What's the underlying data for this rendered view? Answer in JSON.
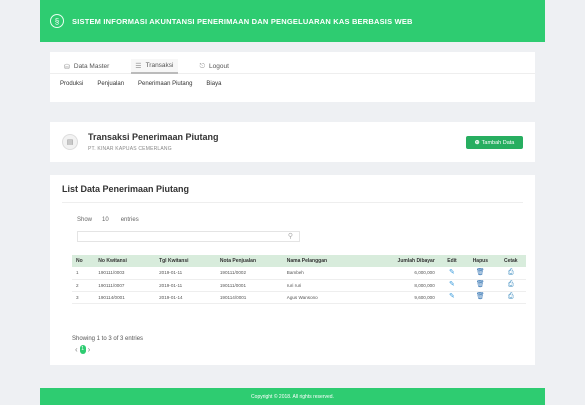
{
  "app": {
    "title": "SISTEM INFORMASI AKUNTANSI PENERIMAAN DAN PENGELUARAN KAS BERBASIS WEB"
  },
  "colors": {
    "accent": "#2ecc71",
    "button_green": "#27ae60",
    "table_header": "#d8ecdc"
  },
  "nav": {
    "main": [
      {
        "label": "Data Master",
        "icon": "database-icon"
      },
      {
        "label": "Transaksi",
        "icon": "list-icon"
      },
      {
        "label": "Logout",
        "icon": "logout-icon"
      }
    ],
    "sub": [
      "Produksi",
      "Penjualan",
      "Penerimaan Piutang",
      "Biaya"
    ]
  },
  "page": {
    "title": "Transaksi Penerimaan Piutang",
    "subtitle": "PT. KINAR KAPUAS CEMERLANG",
    "add_button": "Tambah Data"
  },
  "list": {
    "title": "List Data Penerimaan Piutang",
    "show_label": "Show",
    "show_value": "10",
    "entries_label": "entries",
    "columns": [
      "No",
      "No Kwitansi",
      "Tgl Kwitansi",
      "Nota Penjualan",
      "Nama Pelanggan",
      "Jumlah Dibayar",
      "Edit",
      "Hapus",
      "Cetak"
    ],
    "rows": [
      {
        "no": "1",
        "kwitansi": "190111/0003",
        "tgl": "2019-01-11",
        "nota": "190111/0002",
        "pelanggan": "Bambeh",
        "jumlah": "6,000,000"
      },
      {
        "no": "2",
        "kwitansi": "190111/0007",
        "tgl": "2019-01-11",
        "nota": "190111/0001",
        "pelanggan": "ruri ruri",
        "jumlah": "8,000,000"
      },
      {
        "no": "3",
        "kwitansi": "190114/0001",
        "tgl": "2019-01-14",
        "nota": "190114/0001",
        "pelanggan": "Agus Wansono",
        "jumlah": "9,600,000"
      }
    ],
    "info": "Showing 1 to 3 of 3 entries",
    "page_current": "1"
  },
  "footer": {
    "copyright": "Copyright © 2018. All rights reserved."
  }
}
